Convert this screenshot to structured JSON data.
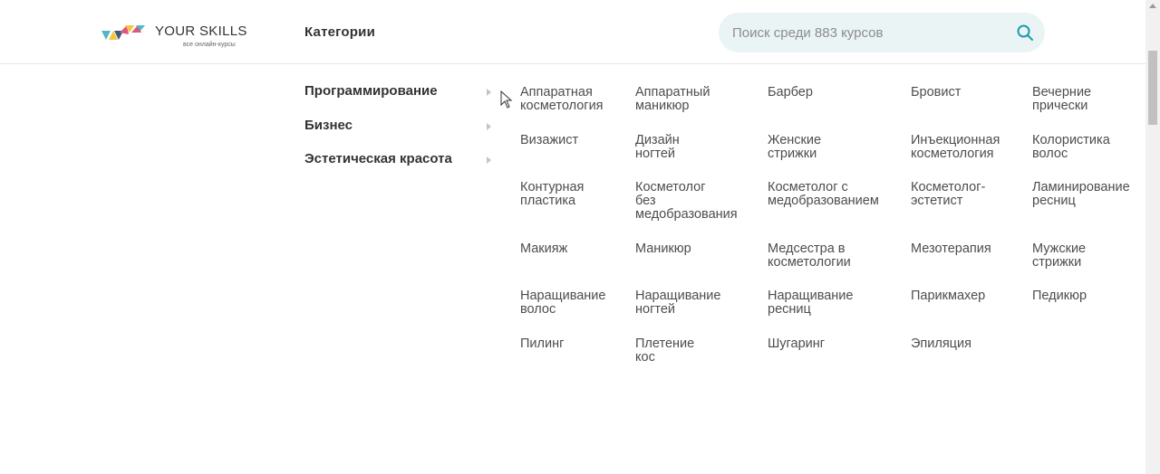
{
  "logo": {
    "title": "YOUR SKILLS",
    "subtitle": "все онлайн-курсы",
    "colors": [
      "#f2c640",
      "#4fb8c4",
      "#e0567a",
      "#3d5a80"
    ]
  },
  "nav": {
    "categories_label": "Категории"
  },
  "search": {
    "placeholder": "Поиск среди 883 курсов",
    "icon": "search-icon",
    "accent": "#1e9bb0"
  },
  "menu": {
    "items": [
      {
        "label": "Программирование"
      },
      {
        "label": "Бизнес"
      },
      {
        "label": "Эстетическая красота"
      }
    ]
  },
  "subcategories": [
    [
      "Аппаратная\nкосметология",
      "Аппаратный\nманикюр",
      "Барбер",
      "Бровист",
      "Вечерние\nпрически"
    ],
    [
      "Визажист",
      "Дизайн\nногтей",
      "Женские\nстрижки",
      "Инъекционная\nкосметология",
      "Колористика\nволос"
    ],
    [
      "Контурная\nпластика",
      "Косметолог\nбез\nмедобразования",
      "Косметолог с\nмедобразованием",
      "Косметолог-\nэстетист",
      "Ламинирование\nресниц"
    ],
    [
      "Макияж",
      "Маникюр",
      "Медсестра в\nкосметологии",
      "Мезотерапия",
      "Мужские\nстрижки"
    ],
    [
      "Наращивание\nволос",
      "Наращивание\nногтей",
      "Наращивание\nресниц",
      "Парикмахер",
      "Педикюр"
    ],
    [
      "Пилинг",
      "Плетение кос",
      "Шугаринг",
      "Эпиляция"
    ]
  ]
}
